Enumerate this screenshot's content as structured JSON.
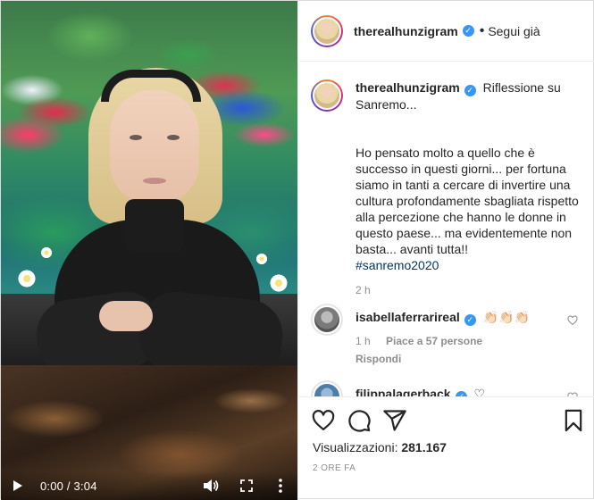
{
  "video": {
    "time": "0:00 / 3:04",
    "play_icon": "play-icon",
    "volume_icon": "volume-icon",
    "fullscreen_icon": "fullscreen-icon",
    "more_icon": "more-vertical-icon"
  },
  "header": {
    "username": "therealhunzigram",
    "separator": "•",
    "follow_label": "Segui già"
  },
  "caption": {
    "username": "therealhunzigram",
    "title": "Riflessione su Sanremo...",
    "body": "Ho pensato molto a quello che è successo in questi giorni... per fortuna siamo in tanti a cercare di invertire una cultura profondamente sbagliata rispetto alla percezione che hanno le donne in questo paese... ma evidentemente non basta... avanti tutta!!",
    "hashtag": "#sanremo2020",
    "time": "2 h"
  },
  "comments": [
    {
      "username": "isabellaferrarireal",
      "text": "👏🏻👏🏻👏🏻",
      "time": "1 h",
      "likes": "Piace a 57 persone",
      "reply": "Rispondi"
    },
    {
      "username": "filippalagerback",
      "text": "♡"
    }
  ],
  "footer": {
    "views_label": "Visualizzazioni:",
    "views_value": "281.167",
    "date": "2 ORE FA"
  },
  "colors": {
    "verified": "#3897f0",
    "hashtag": "#00376b",
    "muted": "#8e8e8e"
  }
}
